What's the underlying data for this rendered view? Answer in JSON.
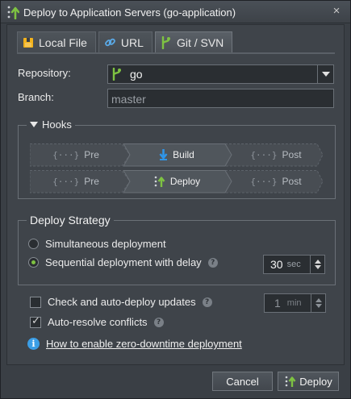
{
  "window": {
    "title": "Deploy to Application Servers (go-application)",
    "close_icon": "×"
  },
  "tabs": [
    {
      "label": "Local File",
      "icon": "archive-icon"
    },
    {
      "label": "URL",
      "icon": "link-icon"
    },
    {
      "label": "Git / SVN",
      "icon": "git-icon",
      "active": true
    }
  ],
  "form": {
    "repository_label": "Repository:",
    "repository_value": "go",
    "branch_label": "Branch:",
    "branch_value": "master"
  },
  "hooks": {
    "legend": "Hooks",
    "row1": {
      "pre": "Pre",
      "mid": "Build",
      "post": "Post"
    },
    "row2": {
      "pre": "Pre",
      "mid": "Deploy",
      "post": "Post"
    },
    "brace": "{···}"
  },
  "strategy": {
    "legend": "Deploy Strategy",
    "option1": "Simultaneous deployment",
    "option2": "Sequential deployment with delay",
    "selected": "option2",
    "delay_value": "30",
    "delay_unit": "sec",
    "help": "?"
  },
  "options": {
    "auto_deploy_label": "Check and auto-deploy updates",
    "auto_deploy_checked": false,
    "interval_value": "1",
    "interval_unit": "min",
    "auto_resolve_label": "Auto-resolve conflicts",
    "auto_resolve_checked": true
  },
  "info": {
    "icon": "i",
    "link_text": "How to enable zero-downtime deployment"
  },
  "buttons": {
    "cancel": "Cancel",
    "deploy": "Deploy"
  },
  "colors": {
    "accent_green": "#7ec242",
    "info_blue": "#3b9ee6",
    "archive_yellow": "#f2b21c",
    "link_blue": "#5aa9e6",
    "build_blue": "#2f95e8"
  }
}
